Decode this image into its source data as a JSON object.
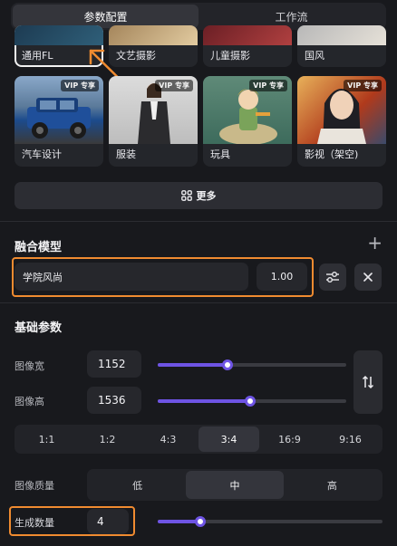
{
  "tabs": [
    {
      "label": "参数配置",
      "active": true
    },
    {
      "label": "工作流",
      "active": false
    }
  ],
  "styles": {
    "row1": [
      {
        "label": "通用FL",
        "selected": true,
        "vip": false,
        "palette": [
          "#1d3b52",
          "#2f5f79"
        ]
      },
      {
        "label": "文艺摄影",
        "selected": false,
        "vip": false,
        "palette": [
          "#a5865c",
          "#e2cba0"
        ]
      },
      {
        "label": "儿童摄影",
        "selected": false,
        "vip": false,
        "palette": [
          "#6b1f25",
          "#b04040"
        ]
      },
      {
        "label": "国风",
        "selected": false,
        "vip": false,
        "palette": [
          "#b8b8b8",
          "#e6e1d8"
        ]
      }
    ],
    "row2": [
      {
        "label": "汽车设计",
        "vip": true,
        "vip_text": "VIP 专享",
        "palette": [
          "#1c4b8c",
          "#8aa8c9"
        ]
      },
      {
        "label": "服装",
        "vip": true,
        "vip_text": "VIP 专享",
        "palette": [
          "#c7c7c7",
          "#eaeaea"
        ]
      },
      {
        "label": "玩具",
        "vip": true,
        "vip_text": "VIP 专享",
        "palette": [
          "#3d6b5c",
          "#d89a48"
        ]
      },
      {
        "label": "影视（架空)",
        "vip": true,
        "vip_text": "VIP 专享",
        "palette": [
          "#b03a1c",
          "#e8b15a"
        ]
      }
    ]
  },
  "more_button": {
    "icon": "grid-icon",
    "label": "更多"
  },
  "fusion": {
    "title": "融合模型",
    "add_icon": "plus-icon",
    "model_name": "学院风尚",
    "weight": "1.00",
    "settings_icon": "sliders-icon",
    "remove_icon": "close-icon"
  },
  "basic": {
    "title": "基础参数",
    "width": {
      "label": "图像宽",
      "value": "1152",
      "fraction": 0.37
    },
    "height": {
      "label": "图像高",
      "value": "1536",
      "fraction": 0.49
    },
    "swap_icon": "swap-arrows-icon",
    "ratios": [
      {
        "label": "1:1",
        "active": false
      },
      {
        "label": "1:2",
        "active": false
      },
      {
        "label": "4:3",
        "active": false
      },
      {
        "label": "3:4",
        "active": true
      },
      {
        "label": "16:9",
        "active": false
      },
      {
        "label": "9:16",
        "active": false
      }
    ],
    "quality": {
      "label": "图像质量",
      "options": [
        {
          "label": "低",
          "active": false
        },
        {
          "label": "中",
          "active": true
        },
        {
          "label": "高",
          "active": false
        }
      ]
    },
    "count": {
      "label": "生成数量",
      "value": "4",
      "fraction": 0.19
    }
  },
  "colors": {
    "accent": "#6e54e4",
    "highlight": "#f08b30"
  }
}
